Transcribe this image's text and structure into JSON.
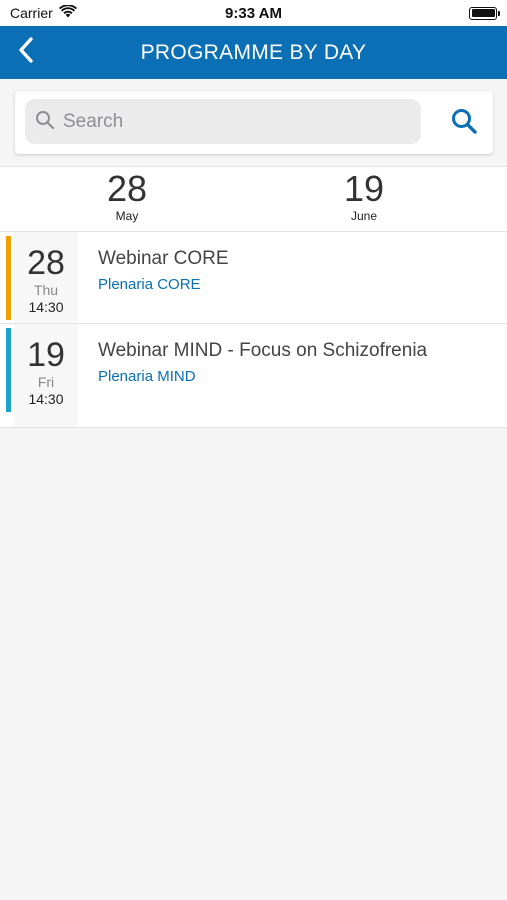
{
  "status_bar": {
    "carrier": "Carrier",
    "time": "9:33 AM",
    "icons": [
      "wifi-icon",
      "battery-icon"
    ]
  },
  "nav": {
    "title": "PROGRAMME BY DAY",
    "back_icon": "chevron-left-icon",
    "color": "#0a6fb5"
  },
  "search": {
    "placeholder": "Search",
    "value": "",
    "icon": "search-icon",
    "button_icon": "search-icon",
    "button_color": "#0a6fb5"
  },
  "days": [
    {
      "day": "28",
      "month": "May"
    },
    {
      "day": "19",
      "month": "June"
    }
  ],
  "sessions": [
    {
      "day": "28",
      "weekday": "Thu",
      "time": "14:30",
      "title": "Webinar CORE",
      "track": "Plenaria CORE",
      "bar_color": "#f0a000",
      "track_color": "#0a6fb5"
    },
    {
      "day": "19",
      "weekday": "Fri",
      "time": "14:30",
      "title": "Webinar MIND - Focus on Schizofrenia",
      "track": "Plenaria MIND",
      "bar_color": "#1aa3c8",
      "track_color": "#0a6fb5"
    }
  ]
}
